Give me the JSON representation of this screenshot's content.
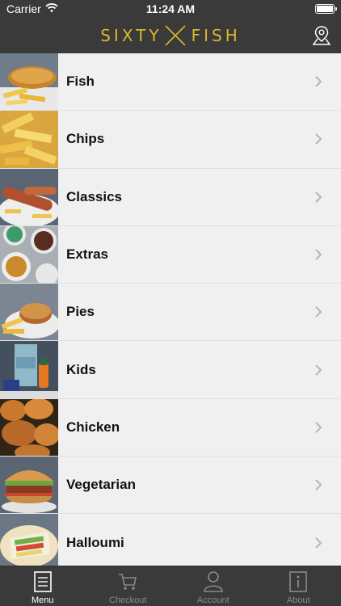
{
  "status_bar": {
    "carrier": "Carrier",
    "time": "11:24 AM"
  },
  "header": {
    "logo_left": "SIXTY",
    "logo_right": "FISH",
    "accent_color": "#d9b92b",
    "map_icon": "map-pin-icon"
  },
  "menu": {
    "items": [
      {
        "label": "Fish",
        "thumb": "fish-and-chips"
      },
      {
        "label": "Chips",
        "thumb": "chips"
      },
      {
        "label": "Classics",
        "thumb": "sausage"
      },
      {
        "label": "Extras",
        "thumb": "sauce-pots"
      },
      {
        "label": "Pies",
        "thumb": "pie"
      },
      {
        "label": "Kids",
        "thumb": "kids-meal"
      },
      {
        "label": "Chicken",
        "thumb": "fried-chicken"
      },
      {
        "label": "Vegetarian",
        "thumb": "veggie-burger"
      },
      {
        "label": "Halloumi",
        "thumb": "halloumi-wrap"
      }
    ]
  },
  "tabs": [
    {
      "label": "Menu",
      "icon": "menu-list-icon",
      "active": true
    },
    {
      "label": "Checkout",
      "icon": "cart-icon",
      "active": false
    },
    {
      "label": "Account",
      "icon": "user-icon",
      "active": false
    },
    {
      "label": "About",
      "icon": "info-icon",
      "active": false
    }
  ]
}
